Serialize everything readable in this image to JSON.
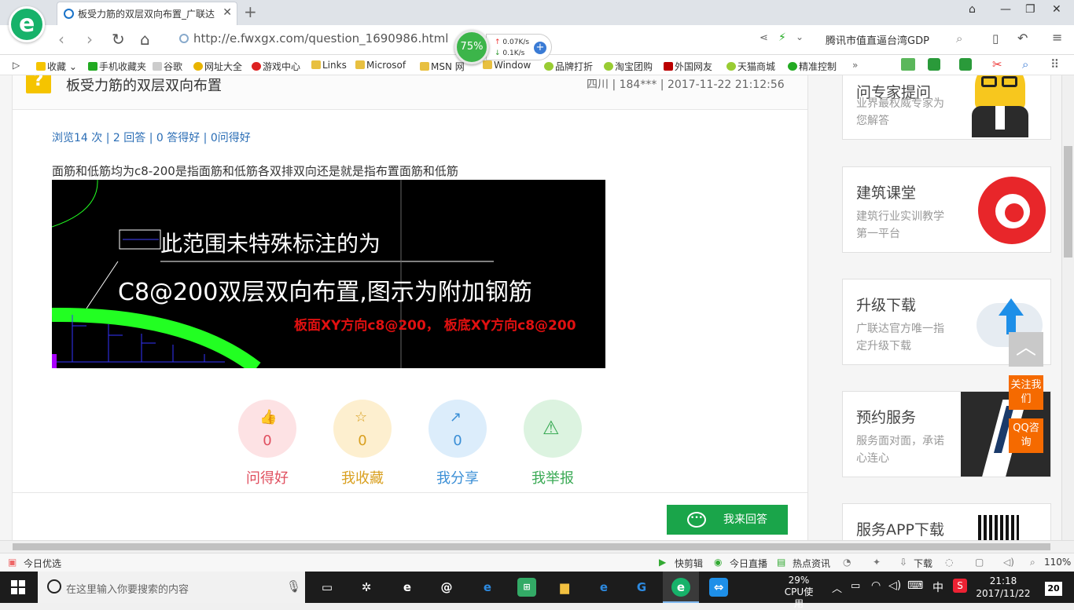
{
  "browser": {
    "tab_title": "板受力筋的双层双向布置_广联达",
    "url": "http://e.fwxgx.com/question_1690986.html",
    "speed_percent": "75%",
    "upload_speed": "0.07K/s",
    "download_speed": "0.1K/s",
    "search_suggestion": "腾讯市值直逼台湾GDP"
  },
  "bookmarks": [
    "收藏",
    "手机收藏夹",
    "谷歌",
    "网址大全",
    "游戏中心",
    "Links",
    "Microsof",
    "MSN 网",
    "Window",
    "品牌打折",
    "淘宝团购",
    "外国网友",
    "天猫商城",
    "精准控制"
  ],
  "question": {
    "icon_text": "?",
    "title": "板受力筋的双层双向布置",
    "meta": "四川 | 184*** | 2017-11-22 21:12:56",
    "stats": "浏览14 次 | 2 回答 | 0 答得好 | 0问得好",
    "body": "面筋和低筋均为c8-200是指面筋和低筋各双排双向还是就是指布置面筋和低筋",
    "cad_line1": "此范围未特殊标注的为",
    "cad_line2": "C8@200双层双向布置,图示为附加钢筋",
    "annotation": "板面XY方向c8@200， 板底XY方向c8@200"
  },
  "actions": [
    {
      "count": "0",
      "label": "问得好",
      "color": "#e04f5f",
      "bg": "#fde2e4"
    },
    {
      "count": "0",
      "label": "我收藏",
      "color": "#d9a020",
      "bg": "#fdefcf"
    },
    {
      "count": "0",
      "label": "我分享",
      "color": "#3b8fd6",
      "bg": "#dcedfb"
    },
    {
      "count": "0",
      "label": "我举报",
      "color": "#3aaa55",
      "bg": "#dcf3e0"
    }
  ],
  "answer_button": "我来回答",
  "sidebar": [
    {
      "title": "问专家提问",
      "desc": "业界最权威专家为您解答"
    },
    {
      "title": "建筑课堂",
      "desc": "建筑行业实训教学第一平台"
    },
    {
      "title": "升级下载",
      "desc": "广联达官方唯一指定升级下载"
    },
    {
      "title": "预约服务",
      "desc": "服务面对面，承诺心连心"
    },
    {
      "title": "服务APP下载",
      "desc": ""
    }
  ],
  "float": {
    "follow": "关注我们",
    "qq": "QQ咨询"
  },
  "statusbar": {
    "left": "今日优选",
    "items": [
      "快剪辑",
      "今日直播",
      "热点资讯",
      "下载"
    ],
    "zoom": "110%"
  },
  "taskbar": {
    "search_placeholder": "在这里输入你要搜索的内容",
    "cpu_percent": "29%",
    "cpu_label": "CPU使用",
    "ime": "中",
    "time": "21:18",
    "date": "2017/11/22",
    "notifications": "20"
  }
}
